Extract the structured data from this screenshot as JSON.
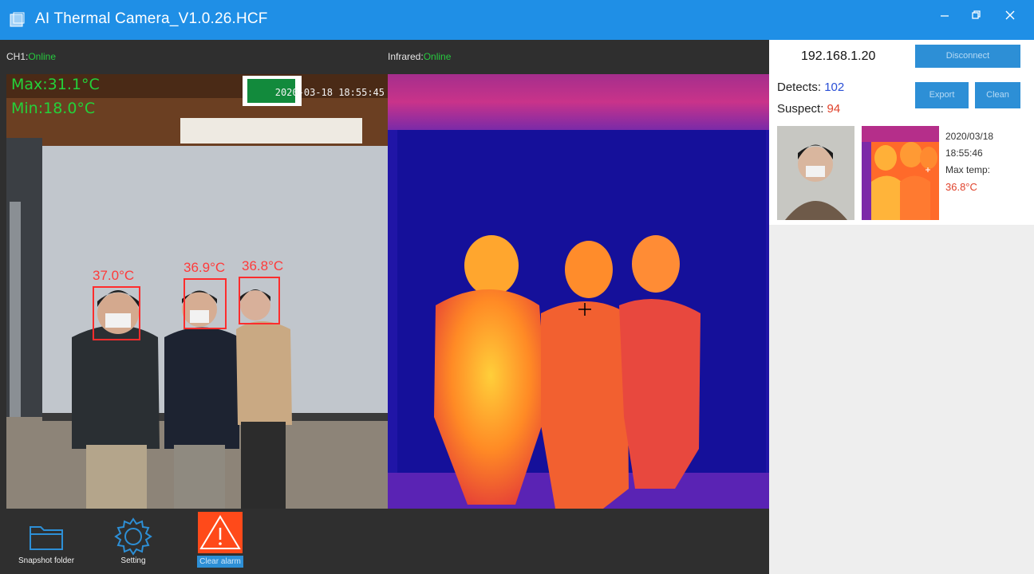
{
  "window": {
    "title": "AI Thermal Camera_V1.0.26.HCF",
    "controls": [
      "minimize",
      "restore",
      "close"
    ]
  },
  "channels": {
    "ch1_label": "CH1:",
    "ch1_status": "Online",
    "infrared_label": "Infrared:",
    "infrared_status": "Online"
  },
  "rgb_view": {
    "max_temp": "Max:31.1°C",
    "min_temp": "Min:18.0°C",
    "timestamp": "2020-03-18  18:55:45",
    "face_temps": [
      "37.0°C",
      "36.9°C",
      "36.8°C"
    ]
  },
  "toolbar": {
    "snapshot_folder": "Snapshot folder",
    "setting": "Setting",
    "clear_alarm": "Clear alarm"
  },
  "panel": {
    "ip": "192.168.1.20",
    "disconnect": "Disconnect",
    "detects_label": "Detects:",
    "detects_value": "102",
    "suspect_label": "Suspect:",
    "suspect_value": "94",
    "export": "Export",
    "clean": "Clean",
    "snapshot": {
      "date": "2020/03/18",
      "time": "18:55:46",
      "max_temp_label": "Max temp:",
      "max_temp_value": "36.8°C"
    }
  },
  "colors": {
    "titlebar": "#1f8fe6",
    "online": "#27c93f",
    "alarm": "#ff4a1a",
    "button": "#2d8fd6"
  }
}
